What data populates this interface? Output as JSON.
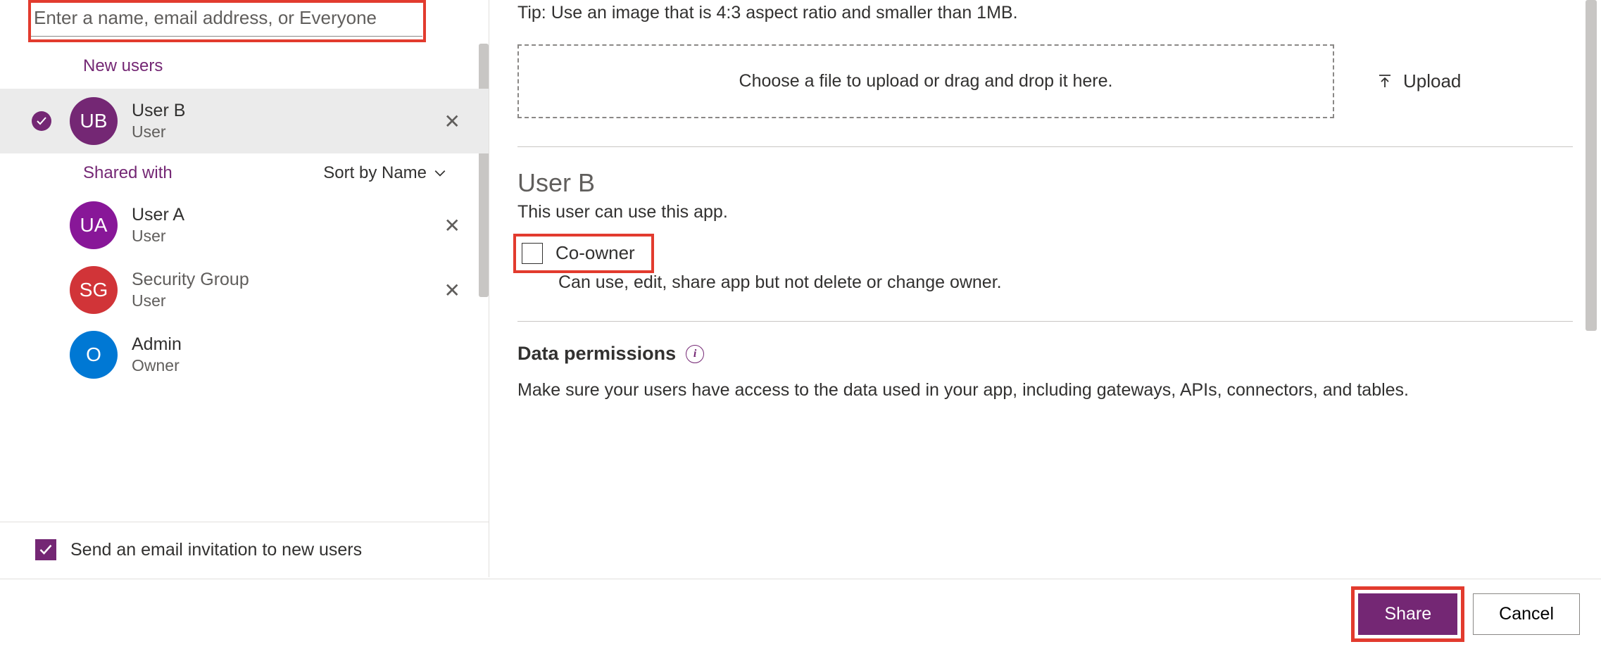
{
  "search": {
    "placeholder": "Enter a name, email address, or Everyone"
  },
  "sections": {
    "new_users": "New users",
    "shared_with": "Shared with",
    "sort_label": "Sort by Name"
  },
  "users": {
    "selected": {
      "initials": "UB",
      "name": "User B",
      "role": "User"
    },
    "shared": [
      {
        "initials": "UA",
        "name": "User A",
        "role": "User",
        "color": "purple"
      },
      {
        "initials": "SG",
        "name": "Security Group",
        "role": "User",
        "color": "red"
      },
      {
        "initials": "O",
        "name": "Admin",
        "role": "Owner",
        "color": "blue"
      }
    ]
  },
  "email_invite": {
    "label": "Send an email invitation to new users",
    "checked": true
  },
  "upload": {
    "tip": "Tip: Use an image that is 4:3 aspect ratio and smaller than 1MB.",
    "dropzone": "Choose a file to upload or drag and drop it here.",
    "button": "Upload"
  },
  "detail": {
    "title": "User B",
    "subtitle": "This user can use this app.",
    "coowner_label": "Co-owner",
    "coowner_desc": "Can use, edit, share app but not delete or change owner."
  },
  "data_permissions": {
    "title": "Data permissions",
    "text": "Make sure your users have access to the data used in your app, including gateways, APIs, connectors, and tables."
  },
  "footer": {
    "share": "Share",
    "cancel": "Cancel"
  }
}
